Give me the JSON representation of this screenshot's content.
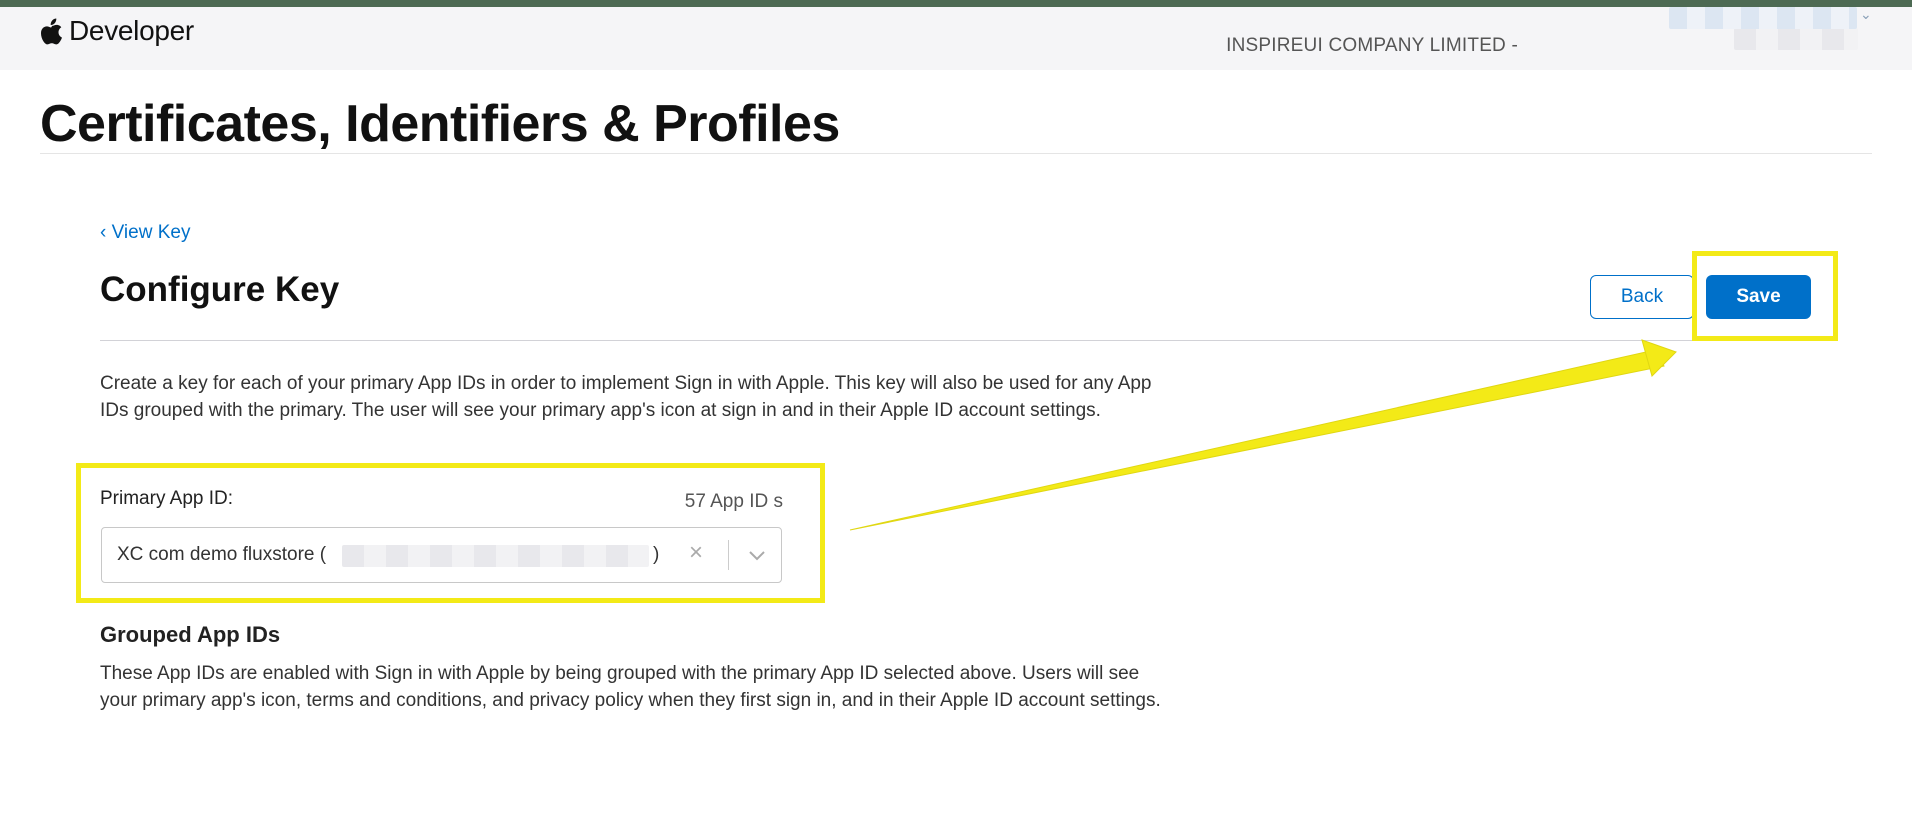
{
  "globalnav": {
    "brand_text": "Developer",
    "team_name": "INSPIREUI COMPANY LIMITED -"
  },
  "page": {
    "title": "Certificates, Identifiers & Profiles"
  },
  "configure": {
    "back_link": "‹ View Key",
    "title": "Configure Key",
    "back_button": "Back",
    "save_button": "Save",
    "description": "Create a key for each of your primary App IDs in order to implement Sign in with Apple. This key will also be used for any App IDs grouped with the primary. The user will see your primary app's icon at sign in and in their Apple ID account settings.",
    "primary_label": "Primary App ID:",
    "app_id_count": "57 App ID s",
    "selected_value": "XC com demo fluxstore (",
    "selected_value_close": ")",
    "clear_icon": "×",
    "grouped_title": "Grouped App IDs",
    "grouped_description": "These App IDs are enabled with Sign in with Apple by being grouped with the primary App ID selected above. Users will see your primary app's icon, terms and conditions, and privacy policy when they first sign in, and in their Apple ID account settings."
  },
  "icons": {
    "brand": "apple-logo-icon",
    "clear": "close-icon",
    "dropdown": "chevron-down-icon",
    "account": "chevron-down-icon"
  },
  "colors": {
    "accent": "#0070c9",
    "highlight": "#f3ea17",
    "top_strip": "#4d6a53",
    "nav_background": "#f5f5f7"
  }
}
